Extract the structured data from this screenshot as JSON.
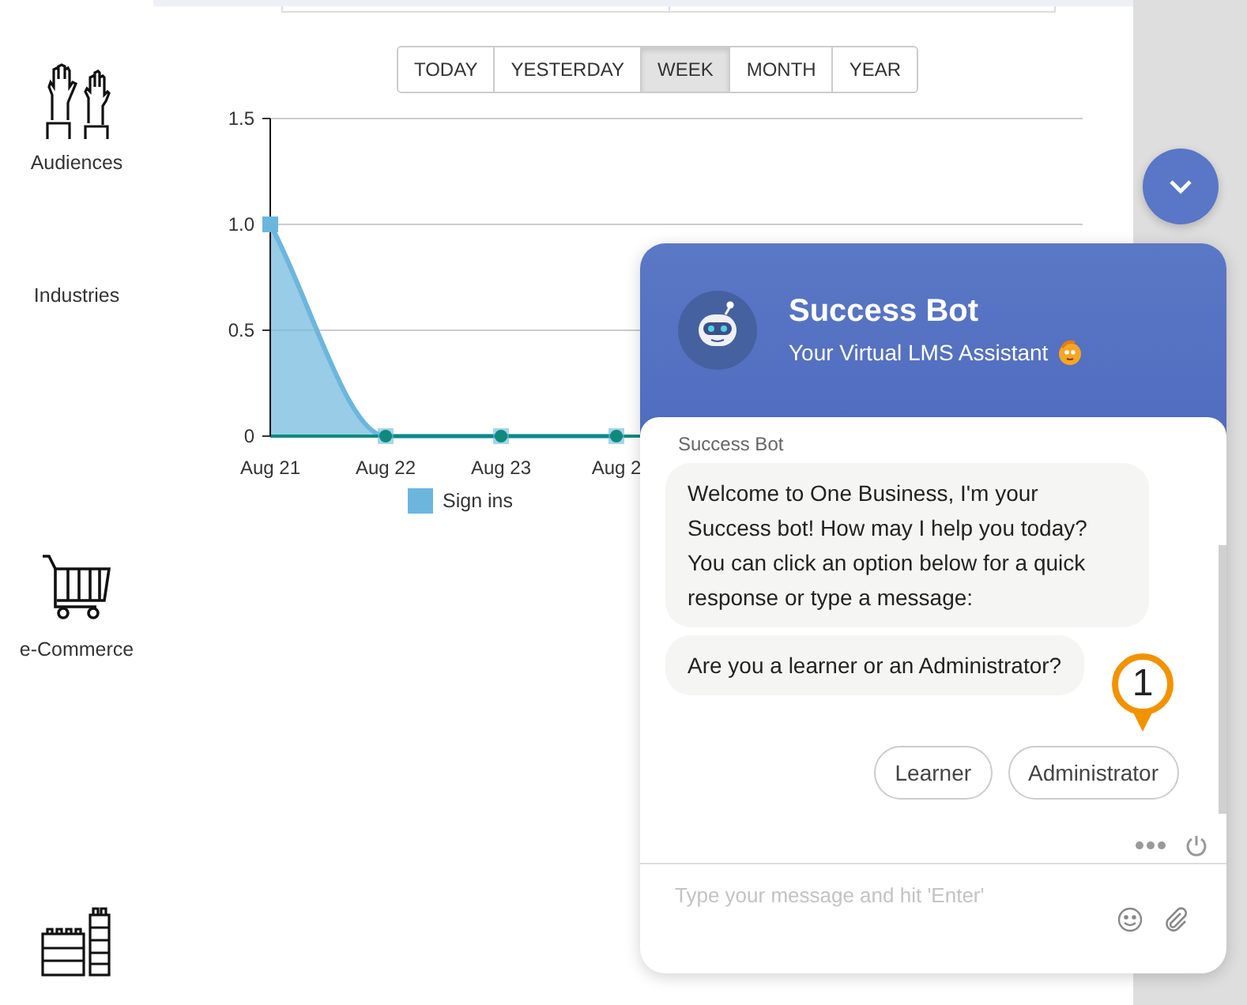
{
  "sidebar": {
    "items": [
      {
        "label": "Audiences"
      },
      {
        "label": "Industries"
      },
      {
        "label": "e-Commerce"
      }
    ]
  },
  "range_buttons": [
    {
      "label": "TODAY",
      "selected": false
    },
    {
      "label": "YESTERDAY",
      "selected": false
    },
    {
      "label": "WEEK",
      "selected": true
    },
    {
      "label": "MONTH",
      "selected": false
    },
    {
      "label": "YEAR",
      "selected": false
    }
  ],
  "chart": {
    "chart_data": {
      "type": "area",
      "categories": [
        "Aug 21",
        "Aug 22",
        "Aug 23",
        "Aug 2"
      ],
      "series": [
        {
          "name": "Sign ins",
          "color": "#6cb6dd",
          "values": [
            1,
            0,
            0,
            0
          ]
        }
      ],
      "ylim": [
        0,
        1.5
      ],
      "yticks": [
        {
          "value": 0,
          "label": "0"
        },
        {
          "value": 0.5,
          "label": "0.5"
        },
        {
          "value": 1,
          "label": "1.0"
        },
        {
          "value": 1.5,
          "label": "1.5"
        }
      ]
    }
  },
  "chat": {
    "header": {
      "title": "Success Bot",
      "subtitle": "Your Virtual LMS Assistant"
    },
    "sender": "Success Bot",
    "messages": [
      "Welcome to One Business, I'm your Success bot! How may I help you today? You can click an option below for a quick response or type a message:",
      "Are you a learner or an Administrator?"
    ],
    "marker": "1",
    "quick_replies": [
      "Learner",
      "Administrator"
    ],
    "input": {
      "placeholder": "Type your message and hit 'Enter'"
    }
  }
}
